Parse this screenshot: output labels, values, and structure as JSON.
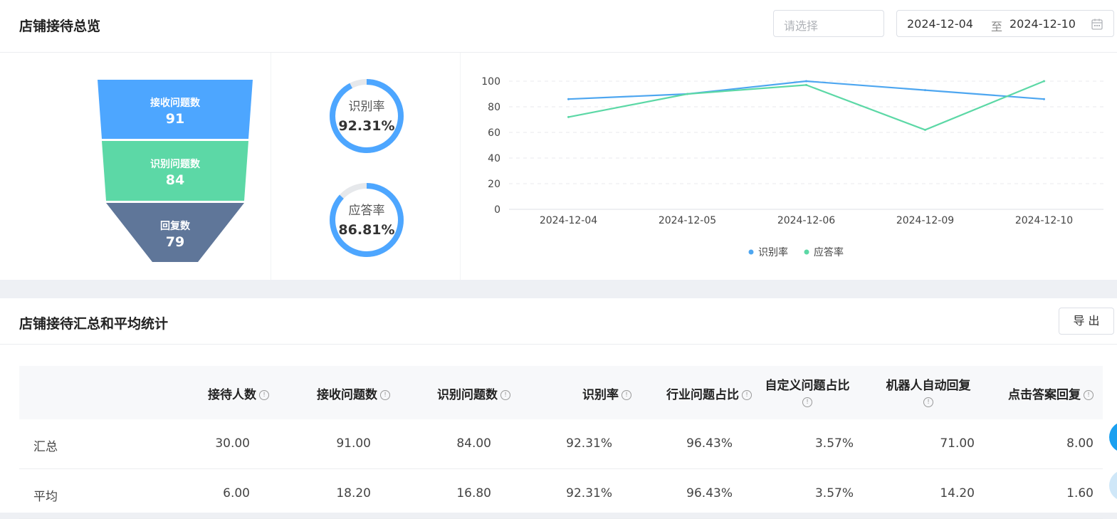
{
  "overview": {
    "title": "店铺接待总览",
    "select_placeholder": "请选择",
    "date_start": "2024-12-04",
    "date_sep": "至",
    "date_end": "2024-12-10",
    "funnel": [
      {
        "label": "接收问题数",
        "value": "91",
        "color": "#4da6ff"
      },
      {
        "label": "识别问题数",
        "value": "84",
        "color": "#5cd8a6"
      },
      {
        "label": "回复数",
        "value": "79",
        "color": "#5f7699"
      }
    ],
    "gauges": [
      {
        "label": "识别率",
        "value": "92.31%",
        "fraction": 0.9231
      },
      {
        "label": "应答率",
        "value": "86.81%",
        "fraction": 0.8681
      }
    ]
  },
  "chart_data": {
    "type": "line",
    "categories": [
      "2024-12-04",
      "2024-12-05",
      "2024-12-06",
      "2024-12-09",
      "2024-12-10"
    ],
    "series": [
      {
        "name": "识别率",
        "values": [
          86,
          90,
          100,
          93,
          86
        ],
        "color": "#4da6f0"
      },
      {
        "name": "应答率",
        "values": [
          72,
          90,
          97,
          62,
          100
        ],
        "color": "#5cd8a6"
      }
    ],
    "ylim": [
      0,
      100
    ],
    "yticks": [
      "0",
      "20",
      "40",
      "60",
      "80",
      "100"
    ],
    "legend_position": "bottom-center",
    "grid": true
  },
  "summary": {
    "title": "店铺接待汇总和平均统计",
    "export_label": "导 出",
    "columns": [
      {
        "label": "接待人数"
      },
      {
        "label": "接收问题数"
      },
      {
        "label": "识别问题数"
      },
      {
        "label": "识别率"
      },
      {
        "label": "行业问题占比"
      },
      {
        "label": "自定义问题占比"
      },
      {
        "label": "机器人自动回复"
      },
      {
        "label": "点击答案回复"
      }
    ],
    "info_glyph": "!",
    "rows": [
      {
        "label": "汇总",
        "cells": [
          "30.00",
          "91.00",
          "84.00",
          "92.31%",
          "96.43%",
          "3.57%",
          "71.00",
          "8.00"
        ]
      },
      {
        "label": "平均",
        "cells": [
          "6.00",
          "18.20",
          "16.80",
          "92.31%",
          "96.43%",
          "3.57%",
          "14.20",
          "1.60"
        ]
      }
    ]
  }
}
